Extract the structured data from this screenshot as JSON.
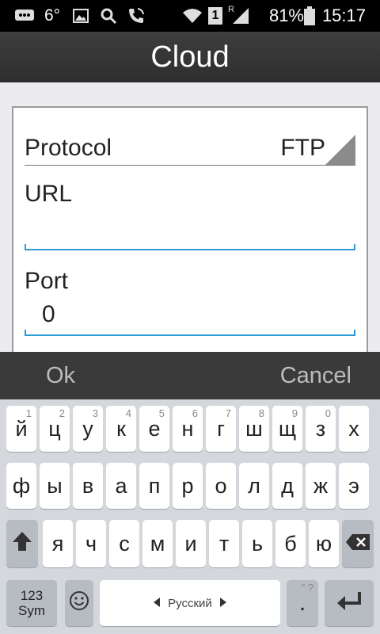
{
  "status": {
    "temperature": "6°",
    "sim_slot": "1",
    "roaming": "R",
    "battery": "81%",
    "time": "15:17"
  },
  "title": "Cloud",
  "form": {
    "protocol_label": "Protocol",
    "protocol_value": "FTP",
    "url_label": "URL",
    "url_value": "",
    "port_label": "Port",
    "port_value": "0"
  },
  "actions": {
    "ok": "Ok",
    "cancel": "Cancel"
  },
  "keyboard": {
    "row1": [
      {
        "k": "й",
        "h": "1"
      },
      {
        "k": "ц",
        "h": "2"
      },
      {
        "k": "у",
        "h": "3"
      },
      {
        "k": "к",
        "h": "4"
      },
      {
        "k": "е",
        "h": "5"
      },
      {
        "k": "н",
        "h": "6"
      },
      {
        "k": "г",
        "h": "7"
      },
      {
        "k": "ш",
        "h": "8"
      },
      {
        "k": "щ",
        "h": "9"
      },
      {
        "k": "з",
        "h": "0"
      },
      {
        "k": "х",
        "h": ""
      }
    ],
    "row2": [
      "ф",
      "ы",
      "в",
      "а",
      "п",
      "р",
      "о",
      "л",
      "д",
      "ж",
      "э"
    ],
    "row3": [
      "я",
      "ч",
      "с",
      "м",
      "и",
      "т",
      "ь",
      "б",
      "ю"
    ],
    "sym_top": "123",
    "sym_bottom": "Sym",
    "space_label": "Русский",
    "period": ".",
    "period_hint": "\" ?"
  }
}
